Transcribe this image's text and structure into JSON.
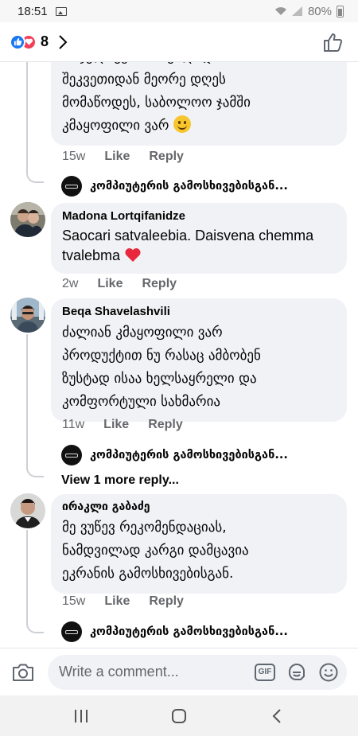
{
  "status_bar": {
    "time": "18:51",
    "battery": "80%"
  },
  "header": {
    "reaction_count": "8"
  },
  "comments": [
    {
      "name": "",
      "text_lines": [
        "შეკვეთიდან მეორე დღეს",
        "მომაწოდეს, საბოლოო ჯამში",
        "კმაყოფილი ვარ"
      ],
      "time": "15w",
      "like": "Like",
      "reply": "Reply",
      "reply_preview": {
        "name": "კომპიუტერის გამოსხივებისგან..."
      }
    },
    {
      "name": "Madona Lortqifanidze",
      "text_lines": [
        "Saocari satvaleebia. Daisvena chemma",
        "tvalebma"
      ],
      "time": "2w",
      "like": "Like",
      "reply": "Reply"
    },
    {
      "name": "Beqa Shavelashvili",
      "text_lines": [
        "ძალიან კმაყოფილი ვარ",
        "პროდუქტით ნუ რასაც ამბობენ",
        "ზუსტად ისაა ხელსაყრელი და",
        "კომფორტული სახმარია"
      ],
      "time": "11w",
      "like": "Like",
      "reply": "Reply",
      "reply_preview": {
        "name": "კომპიუტერის გამოსხივებისგან..."
      },
      "view_more": "View 1 more reply..."
    },
    {
      "name": "ირაკლი გაბაძე",
      "text_lines": [
        "მე ვუწევ რეკომენდაციას,",
        "ნამდვილად კარგი დამცავია",
        "ეკრანის გამოსხივებისგან."
      ],
      "time": "15w",
      "like": "Like",
      "reply": "Reply",
      "reply_preview": {
        "name": "კომპიუტერის გამოსხივებისგან..."
      }
    }
  ],
  "composer": {
    "placeholder": "Write a comment..."
  },
  "icons": {
    "reaction_like": "thumbs-up-icon",
    "reaction_love": "heart-icon",
    "header_thumb": "thumbs-up-outline-icon",
    "camera": "camera-icon",
    "gif": "gif-icon",
    "sticker": "sticker-icon",
    "emoji": "emoji-icon"
  },
  "colors": {
    "accent": "#1877f2",
    "love": "#f33e58",
    "bubble": "#f0f2f5",
    "secondary_text": "#65676b"
  }
}
